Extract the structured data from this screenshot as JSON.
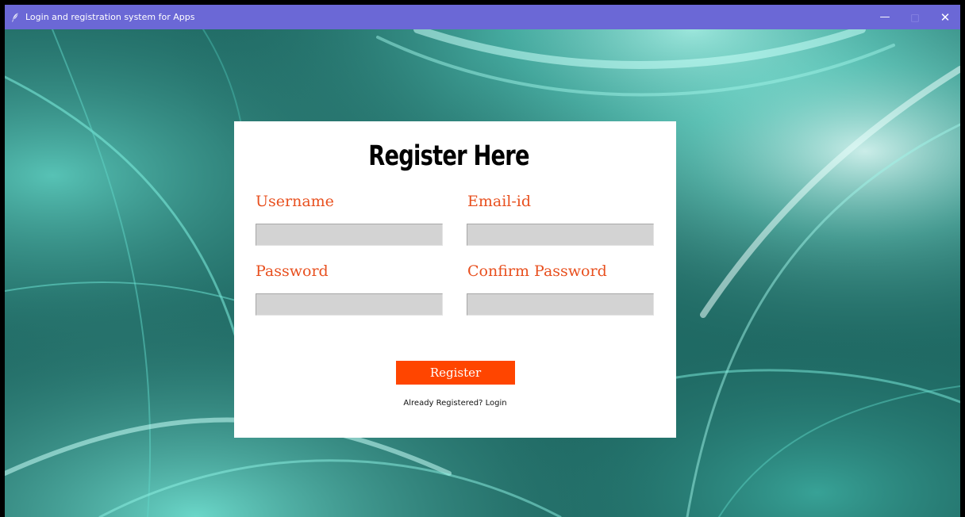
{
  "window": {
    "title": "Login and registration system for Apps",
    "icon": "feather-icon",
    "controls": {
      "minimize": "—",
      "maximize": "□",
      "close": "✕"
    }
  },
  "form": {
    "title": "Register Here",
    "username_label": "Username",
    "email_label": "Email-id",
    "password_label": "Password",
    "confirm_password_label": "Confirm Password",
    "username_value": "",
    "email_value": "",
    "password_value": "",
    "confirm_password_value": "",
    "register_label": "Register",
    "login_link": "Already Registered? Login"
  },
  "colors": {
    "titlebar": "#6b68d6",
    "label": "#e8501f",
    "button": "#ff4500",
    "field": "#d3d3d3",
    "background": "#1e5f5b"
  }
}
